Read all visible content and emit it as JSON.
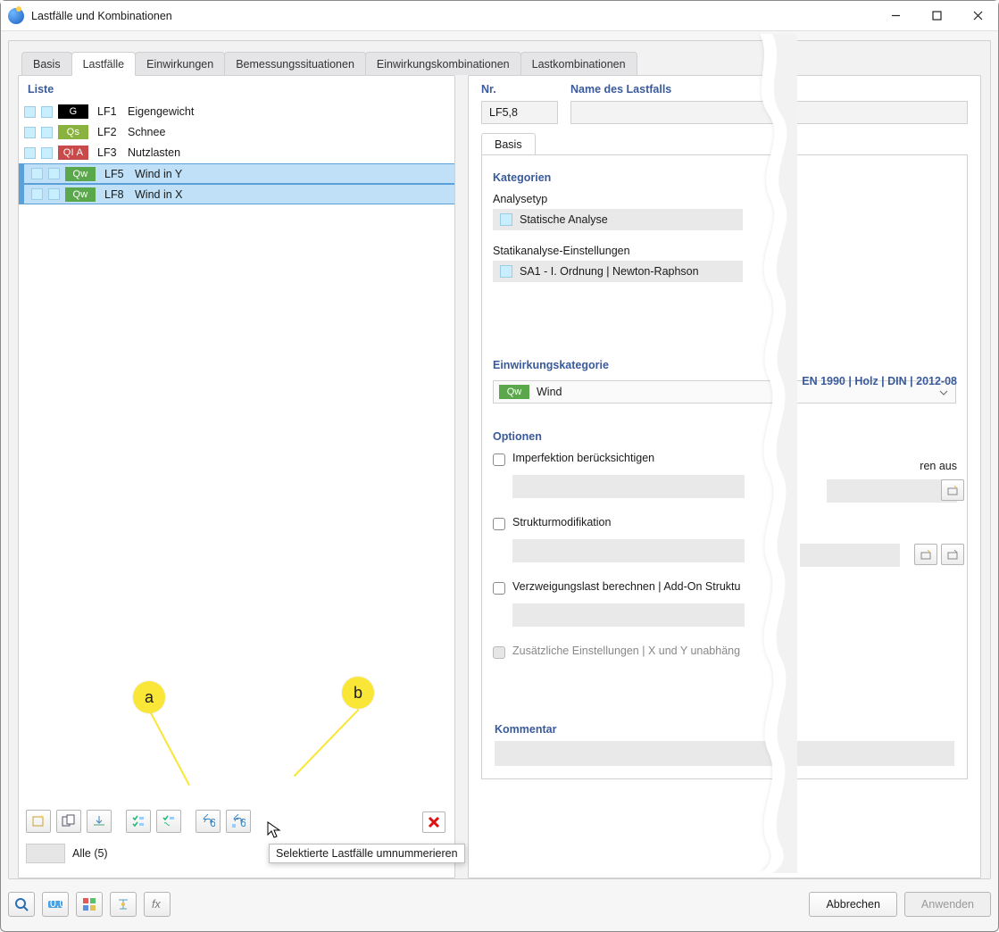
{
  "window": {
    "title": "Lastfälle und Kombinationen"
  },
  "tabs": [
    "Basis",
    "Lastfälle",
    "Einwirkungen",
    "Bemessungssituationen",
    "Einwirkungskombinationen",
    "Lastkombinationen"
  ],
  "active_tab_index": 1,
  "left": {
    "heading": "Liste",
    "items": [
      {
        "badge": "G",
        "badge_kind": "g",
        "lf": "LF1",
        "name": "Eigengewicht",
        "selected": false
      },
      {
        "badge": "Qs",
        "badge_kind": "qs",
        "lf": "LF2",
        "name": "Schnee",
        "selected": false
      },
      {
        "badge": "QI A",
        "badge_kind": "qia",
        "lf": "LF3",
        "name": "Nutzlasten",
        "selected": false
      },
      {
        "badge": "Qw",
        "badge_kind": "qw",
        "lf": "LF5",
        "name": "Wind in Y",
        "selected": true
      },
      {
        "badge": "Qw",
        "badge_kind": "qw",
        "lf": "LF8",
        "name": "Wind in X",
        "selected": true
      }
    ],
    "filter_label": "Alle (5)",
    "tooltip": "Selektierte Lastfälle umnummerieren",
    "toolbar_icons": [
      "new",
      "copy",
      "import",
      "select-all",
      "deselect",
      "renumber-all",
      "renumber-selected"
    ]
  },
  "markers": {
    "a": "a",
    "b": "b"
  },
  "right": {
    "nr_label": "Nr.",
    "nr_value": "LF5,8",
    "name_label": "Name des Lastfalls",
    "name_value": "",
    "subtab": "Basis",
    "section1_title": "Kategorien",
    "analysetyp_label": "Analysetyp",
    "analysetyp_value": "Statische Analyse",
    "statik_label": "Statikanalyse-Einstellungen",
    "statik_value": "SA1 - I. Ordnung | Newton-Raphson",
    "section2_title": "Einwirkungskategorie",
    "norm_text": "EN 1990 | Holz | DIN | 2012-08",
    "einw_badge": "Qw",
    "einw_value": "Wind",
    "section3_title": "Optionen",
    "opt1": "Imperfektion berücksichtigen",
    "opt_right_frag": "ren aus",
    "opt2": "Strukturmodifikation",
    "opt3": "Verzweigungslast berechnen | Add-On Struktu",
    "opt4": "Zusätzliche Einstellungen | X und Y unabhäng",
    "kommentar_title": "Kommentar"
  },
  "footer": {
    "abbrechen": "Abbrechen",
    "anwenden": "Anwenden"
  }
}
